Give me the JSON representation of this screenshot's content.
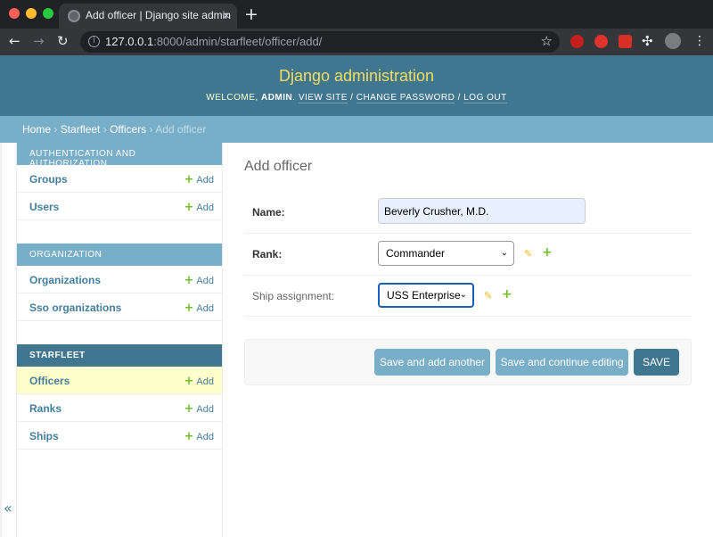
{
  "browser": {
    "tab_title": "Add officer | Django site admin",
    "tab_close": "×",
    "new_tab": "+",
    "url_host": "127.0.0.1",
    "url_path": ":8000/admin/starfleet/officer/add/",
    "nav_back": "←",
    "nav_forward": "→",
    "nav_reload": "↻",
    "bookmark_star": "☆"
  },
  "header": {
    "branding": "Django administration",
    "welcome": "WELCOME,",
    "username": "ADMIN",
    "links": [
      "VIEW SITE",
      "CHANGE PASSWORD",
      "LOG OUT"
    ]
  },
  "breadcrumbs": [
    "Home",
    "Starfleet",
    "Officers",
    "Add officer"
  ],
  "sidebar": {
    "modules": [
      {
        "caption": "AUTHENTICATION AND AUTHORIZATION",
        "selected": false,
        "models": [
          {
            "name": "Groups",
            "add": "Add",
            "current": false
          },
          {
            "name": "Users",
            "add": "Add",
            "current": false
          }
        ]
      },
      {
        "caption": "ORGANIZATION",
        "selected": false,
        "models": [
          {
            "name": "Organizations",
            "add": "Add",
            "current": false
          },
          {
            "name": "Sso organizations",
            "add": "Add",
            "current": false
          }
        ]
      },
      {
        "caption": "STARFLEET",
        "selected": true,
        "models": [
          {
            "name": "Officers",
            "add": "Add",
            "current": true
          },
          {
            "name": "Ranks",
            "add": "Add",
            "current": false
          },
          {
            "name": "Ships",
            "add": "Add",
            "current": false
          }
        ]
      }
    ],
    "collapse_toggle": "«"
  },
  "form": {
    "title": "Add officer",
    "name_label": "Name:",
    "name_value": "Beverly Crusher, M.D.",
    "rank_label": "Rank:",
    "rank_value": "Commander",
    "ship_label": "Ship assignment:",
    "ship_value": "USS Enterprise",
    "chevron": "⌄",
    "pencil": "✎",
    "plus": "+",
    "buttons": {
      "save_add_another": "Save and add another",
      "save_continue": "Save and continue editing",
      "save": "SAVE"
    }
  }
}
